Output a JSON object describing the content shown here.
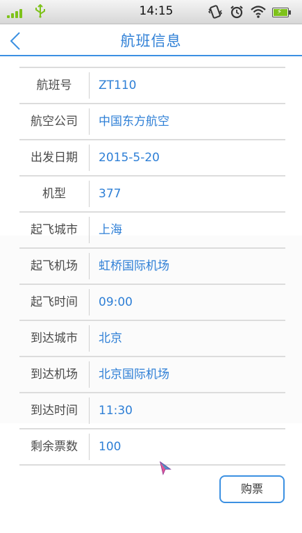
{
  "status_bar": {
    "time": "14:15",
    "icons": [
      "signal-icon",
      "usb-icon",
      "vibrate-icon",
      "alarm-icon",
      "wifi-icon",
      "battery-icon"
    ]
  },
  "nav": {
    "title": "航班信息",
    "back_icon": "chevron-left-icon"
  },
  "flight": {
    "rows": [
      {
        "label": "航班号",
        "value": "ZT110"
      },
      {
        "label": "航空公司",
        "value": "中国东方航空"
      },
      {
        "label": "出发日期",
        "value": "2015-5-20"
      },
      {
        "label": "机型",
        "value": "377"
      },
      {
        "label": "起飞城市",
        "value": "上海"
      },
      {
        "label": "起飞机场",
        "value": "虹桥国际机场"
      },
      {
        "label": "起飞时间",
        "value": "09:00"
      },
      {
        "label": "到达城市",
        "value": "北京"
      },
      {
        "label": "到达机场",
        "value": "北京国际机场"
      },
      {
        "label": "到达时间",
        "value": "11:30"
      },
      {
        "label": "剩余票数",
        "value": "100"
      }
    ]
  },
  "actions": {
    "buy_label": "购票"
  },
  "colors": {
    "accent": "#2e7fd6",
    "label_text": "#4a4a4a",
    "divider": "#dcdcdc"
  }
}
